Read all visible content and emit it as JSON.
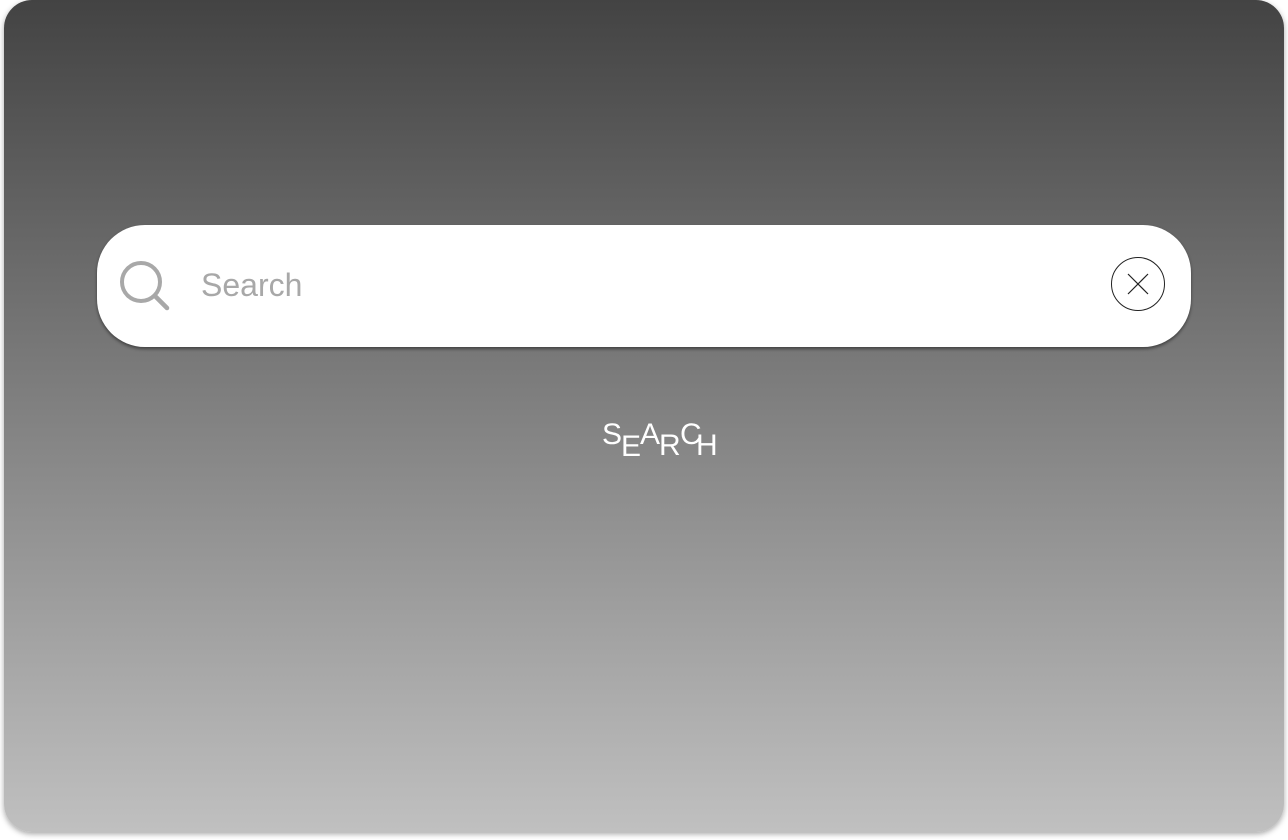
{
  "search": {
    "placeholder": "Search",
    "value": "",
    "clear_icon": "close-icon",
    "search_icon": "search-icon"
  },
  "animated_label": {
    "letters": [
      "S",
      "E",
      "A",
      "R",
      "C",
      "H"
    ]
  },
  "colors": {
    "background_top": "#434343",
    "background_bottom": "#c0c0c0",
    "search_bar": "#ffffff",
    "placeholder": "#a8a8a8",
    "icon": "#a8a8a8",
    "label": "#ffffff"
  }
}
